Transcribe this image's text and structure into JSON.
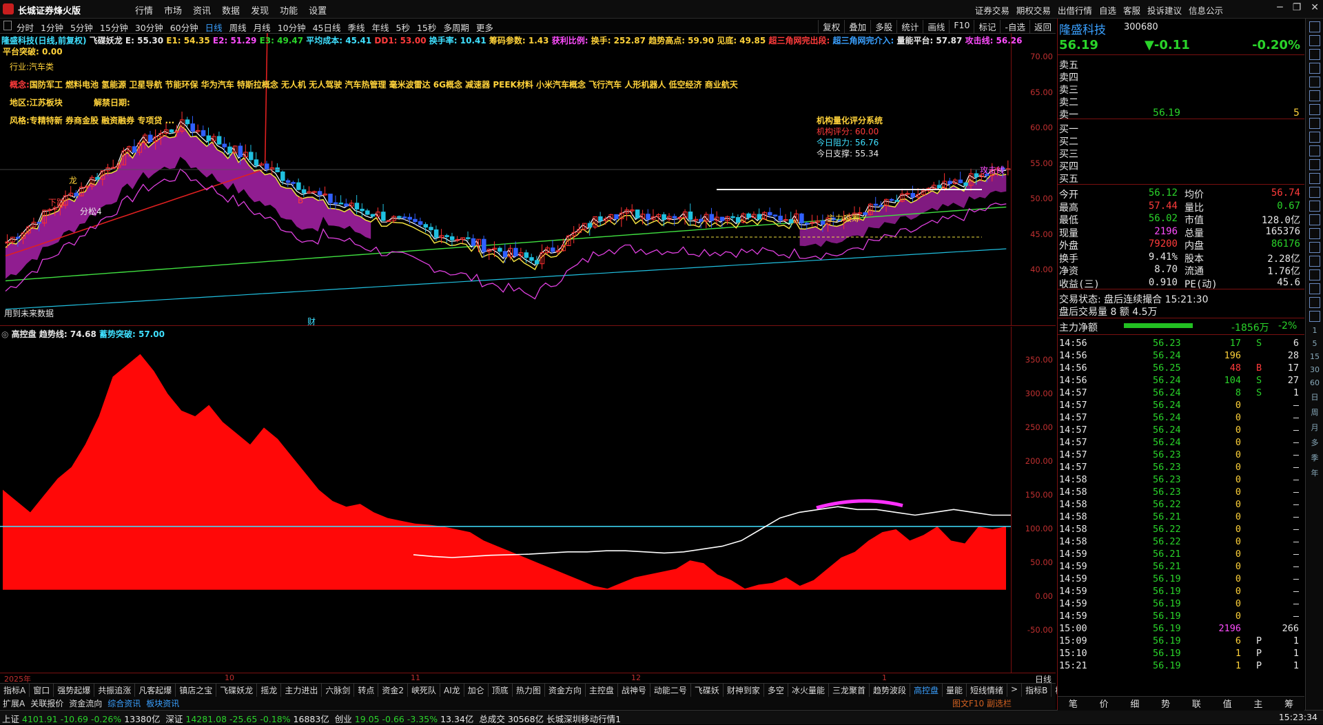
{
  "app": {
    "title": "长城证券烽火版"
  },
  "menu": [
    "行情",
    "市场",
    "资讯",
    "数据",
    "发现",
    "功能",
    "设置"
  ],
  "right_menu": [
    "证券交易",
    "期权交易",
    "出借行情",
    "自选",
    "客服",
    "投诉建议",
    "信息公示"
  ],
  "window_controls": [
    "minimize-icon",
    "restore-icon",
    "close-icon"
  ],
  "periods": [
    "分时",
    "1分钟",
    "5分钟",
    "15分钟",
    "30分钟",
    "60分钟",
    "日线",
    "周线",
    "月线",
    "10分钟",
    "45日线",
    "季线",
    "年线",
    "5秒",
    "15秒",
    "多周期",
    "更多"
  ],
  "active_period": "日线",
  "tool_buttons": [
    "复权",
    "叠加",
    "多股",
    "统计",
    "画线",
    "F10",
    "标记",
    "-自选",
    "返回"
  ],
  "main_info": {
    "stock": "隆盛科技(日线,前复权)",
    "indicator": "飞碟妖龙",
    "E": "E: 55.30",
    "E1": "E1: 54.35",
    "E2": "E2: 51.29",
    "E3": "E3: 49.47",
    "avg_cost": "平均成本: 45.41",
    "DD1": "DD1: 53.00",
    "turnover": "换手率: 10.41",
    "chip": "筹码参数: 1.43",
    "profit_ratio": "获利比例:",
    "turn2": "换手: 252.87",
    "trend_high": "趋势高点: 59.90",
    "peak": "见底: 49.85",
    "tri1": "超三角网完出段:",
    "tri2": "超三角网完介入:",
    "platform": "量能平台: 57.87",
    "attack": "攻击线: 56.26",
    "breakthrough": "平台突破: 0.00"
  },
  "annotations": {
    "industry": "行业:汽车类",
    "concept_label": "概念:",
    "concepts": "国防军工 燃料电池 氢能源 卫星导航 节能环保 华为汽车 特斯拉概念 无人机 无人驾驶 汽车热管理 毫米波雷达 6G概念 减速器 PEEK材料 小米汽车概念 飞行汽车 人形机器人 低空经济 商业航天",
    "region": "地区:江苏板块",
    "style": "风格:专精特新 券商金股 融资融券 专项贷 ...",
    "lift_date": "解禁日期:",
    "future_data": "用到未来数据",
    "fin_mark": "财",
    "score_title": "机构量化评分系统",
    "score": "机构评分: 60.00",
    "resistance": "今日阻力: 56.76",
    "support": "今日支撑: 55.34",
    "attack_line_tag": "攻击线",
    "main_absorb": "主力吸筹",
    "xiping": "洗盘",
    "dragon": "龙",
    "b_mark": "B",
    "fen_mark": "分松4",
    "dyn": "下跌"
  },
  "main_yaxis": [
    "70.00",
    "65.00",
    "60.00",
    "55.00",
    "50.00",
    "45.00",
    "40.00"
  ],
  "sub_info": {
    "name": "高控盘",
    "trend": "趋势线: 74.68",
    "accum": "蓄势突破: 57.00"
  },
  "sub_yaxis": [
    "350.00",
    "300.00",
    "250.00",
    "200.00",
    "150.00",
    "100.00",
    "50.00",
    "0.00",
    "-50.00"
  ],
  "x_axis": [
    "2025年",
    "10",
    "11",
    "12",
    "1"
  ],
  "bottom_right_label": "日线",
  "tabs1": [
    "指标A",
    "窗口",
    "强势起爆",
    "共振追涨",
    "凡客起爆",
    "镇店之宝",
    "飞碟妖龙",
    "摇龙",
    "主力进出",
    "六脉剑",
    "转点",
    "资金2",
    "峡死队",
    "AI龙",
    "加仑",
    "顶底",
    "热力图",
    "资金方向",
    "主控盘",
    "战神号",
    "动能二号",
    "飞碟妖",
    "财神到家",
    "多空",
    "冰火量能",
    "三龙聚首",
    "趋势波段",
    "高控盘",
    "量能",
    "短线情绪",
    ">",
    "指标B",
    "模板"
  ],
  "tabs1_active": "高控盘",
  "tabs2": [
    "扩展A",
    "关联报价",
    "资金流向",
    "综合资讯",
    "板块资讯"
  ],
  "tabs2_right": "图文F10 副选栏",
  "status": {
    "sh_label": "上证",
    "sh_val": "4101.91",
    "sh_chg": "-10.69",
    "sh_pct": "-0.26%",
    "sh_amt": "13380亿",
    "sz_label": "深证",
    "sz_val": "14281.08",
    "sz_chg": "-25.65",
    "sz_pct": "-0.18%",
    "sz_amt": "16883亿",
    "cy_label": "创业",
    "cy_val": "19.05",
    "cy_chg": "-0.66",
    "cy_pct": "-3.35%",
    "cy_amt": "13.34亿",
    "total": "总成交 30568亿",
    "broker": "长城深圳移动行情1",
    "time": "15:23:34"
  },
  "quote": {
    "name": "隆盛科技",
    "code": "300680",
    "price": "56.19",
    "change": "▼-0.11",
    "pct": "-0.20%",
    "sell": [
      "卖五",
      "卖四",
      "卖三",
      "卖二",
      "卖一"
    ],
    "sell1_price": "56.19",
    "sell1_vol": "5",
    "buy": [
      "买一",
      "买二",
      "买三",
      "买四",
      "买五"
    ],
    "stats": [
      [
        "今开",
        "56.12",
        "均价",
        "56.74"
      ],
      [
        "最高",
        "57.44",
        "量比",
        "0.67"
      ],
      [
        "最低",
        "56.02",
        "市值",
        "128.0亿"
      ],
      [
        "现量",
        "2196",
        "总量",
        "165376"
      ],
      [
        "外盘",
        "79200",
        "内盘",
        "86176"
      ],
      [
        "换手",
        "9.41%",
        "股本",
        "2.28亿"
      ],
      [
        "净资",
        "8.70",
        "流通",
        "1.76亿"
      ],
      [
        "收益(三)",
        "0.910",
        "PE(动)",
        "45.6"
      ]
    ],
    "trade_state": "交易状态: 盘后连续撮合 15:21:30",
    "after_hours": "盘后交易量 8 额 4.5万",
    "main_net_label": "主力净额",
    "main_net_val": "-1856万",
    "main_net_pct": "-2%"
  },
  "ticks": [
    [
      "14:56",
      "56.23",
      "17",
      "S",
      "6"
    ],
    [
      "14:56",
      "56.24",
      "196",
      "",
      "28"
    ],
    [
      "14:56",
      "56.25",
      "48",
      "B",
      "17"
    ],
    [
      "14:56",
      "56.24",
      "104",
      "S",
      "27"
    ],
    [
      "14:57",
      "56.24",
      "8",
      "S",
      "1"
    ],
    [
      "14:57",
      "56.24",
      "0",
      "",
      "—"
    ],
    [
      "14:57",
      "56.24",
      "0",
      "",
      "—"
    ],
    [
      "14:57",
      "56.24",
      "0",
      "",
      "—"
    ],
    [
      "14:57",
      "56.24",
      "0",
      "",
      "—"
    ],
    [
      "14:57",
      "56.23",
      "0",
      "",
      "—"
    ],
    [
      "14:57",
      "56.23",
      "0",
      "",
      "—"
    ],
    [
      "14:58",
      "56.23",
      "0",
      "",
      "—"
    ],
    [
      "14:58",
      "56.23",
      "0",
      "",
      "—"
    ],
    [
      "14:58",
      "56.22",
      "0",
      "",
      "—"
    ],
    [
      "14:58",
      "56.21",
      "0",
      "",
      "—"
    ],
    [
      "14:58",
      "56.22",
      "0",
      "",
      "—"
    ],
    [
      "14:58",
      "56.22",
      "0",
      "",
      "—"
    ],
    [
      "14:59",
      "56.21",
      "0",
      "",
      "—"
    ],
    [
      "14:59",
      "56.21",
      "0",
      "",
      "—"
    ],
    [
      "14:59",
      "56.19",
      "0",
      "",
      "—"
    ],
    [
      "14:59",
      "56.19",
      "0",
      "",
      "—"
    ],
    [
      "14:59",
      "56.19",
      "0",
      "",
      "—"
    ],
    [
      "14:59",
      "56.19",
      "0",
      "",
      "—"
    ],
    [
      "15:00",
      "56.19",
      "2196",
      "",
      "266"
    ],
    [
      "15:09",
      "56.19",
      "6",
      "P",
      "1"
    ],
    [
      "15:10",
      "56.19",
      "1",
      "P",
      "1"
    ],
    [
      "15:21",
      "56.19",
      "1",
      "P",
      "1"
    ]
  ],
  "panel_tabs": [
    "笔",
    "价",
    "细",
    "势",
    "联",
    "值",
    "主",
    "筹"
  ],
  "side_labels": [
    "1",
    "5",
    "15",
    "30",
    "60",
    "日",
    "周",
    "月",
    "多",
    "季",
    "年"
  ]
}
